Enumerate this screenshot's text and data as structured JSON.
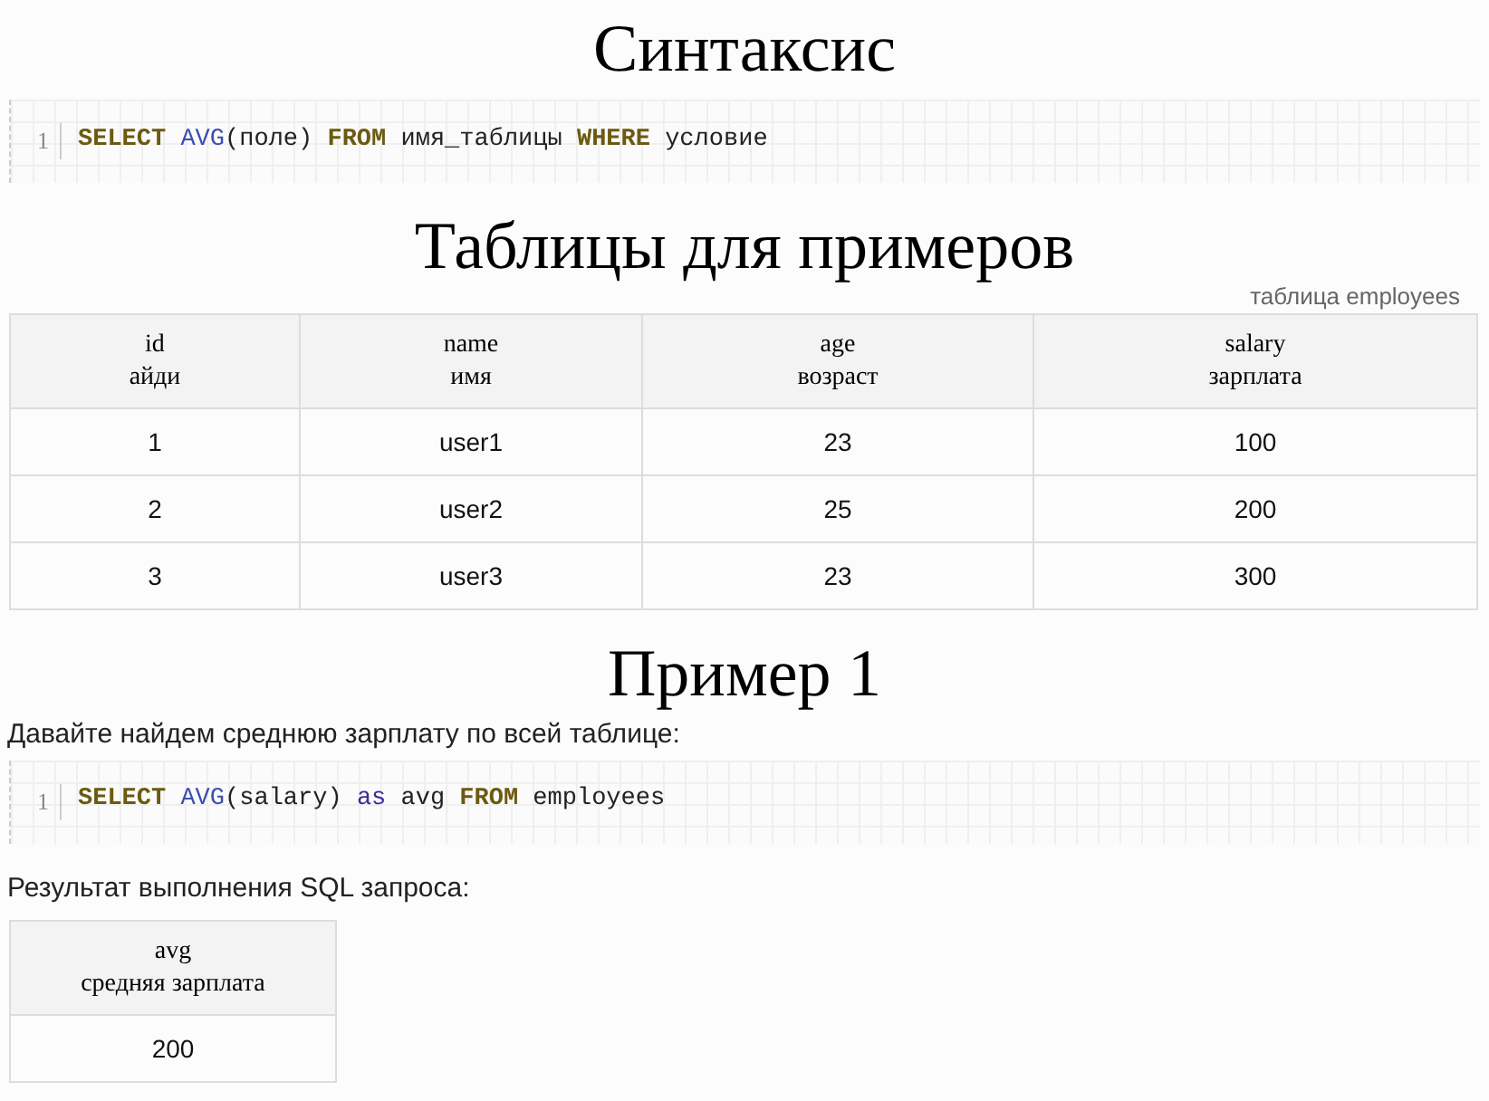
{
  "sections": [
    {
      "kind": "heading",
      "text": "Синтаксис"
    },
    {
      "kind": "code",
      "line_number": "1",
      "tokens": [
        {
          "kind": "keyword",
          "text": "SELECT"
        },
        {
          "kind": "function",
          "text": " AVG"
        },
        {
          "kind": "plain",
          "text": "(поле) "
        },
        {
          "kind": "keyword",
          "text": "FROM"
        },
        {
          "kind": "plain",
          "text": " имя_таблицы "
        },
        {
          "kind": "keyword",
          "text": "WHERE"
        },
        {
          "kind": "plain",
          "text": " условие"
        }
      ]
    },
    {
      "kind": "heading",
      "text": "Таблицы для примеров"
    },
    {
      "kind": "table",
      "caption": "таблица employees",
      "columns": [
        {
          "name": "id",
          "label": "айди"
        },
        {
          "name": "name",
          "label": "имя"
        },
        {
          "name": "age",
          "label": "возраст"
        },
        {
          "name": "salary",
          "label": "зарплата"
        }
      ],
      "rows": [
        [
          "1",
          "user1",
          "23",
          "100"
        ],
        [
          "2",
          "user2",
          "25",
          "200"
        ],
        [
          "3",
          "user3",
          "23",
          "300"
        ]
      ]
    },
    {
      "kind": "heading",
      "text": "Пример 1"
    },
    {
      "kind": "paragraph",
      "text": "Давайте найдем среднюю зарплату по всей таблице:"
    },
    {
      "kind": "code",
      "line_number": "1",
      "tokens": [
        {
          "kind": "keyword",
          "text": "SELECT"
        },
        {
          "kind": "function",
          "text": " AVG"
        },
        {
          "kind": "plain",
          "text": "(salary) "
        },
        {
          "kind": "operator",
          "text": "as"
        },
        {
          "kind": "plain",
          "text": " avg "
        },
        {
          "kind": "keyword",
          "text": "FROM"
        },
        {
          "kind": "plain",
          "text": " employees"
        }
      ]
    },
    {
      "kind": "paragraph",
      "text": "Результат выполнения SQL запроса:"
    },
    {
      "kind": "result_table",
      "columns": [
        {
          "name": "avg",
          "label": "средняя зарплата"
        }
      ],
      "rows": [
        [
          "200"
        ]
      ]
    }
  ]
}
